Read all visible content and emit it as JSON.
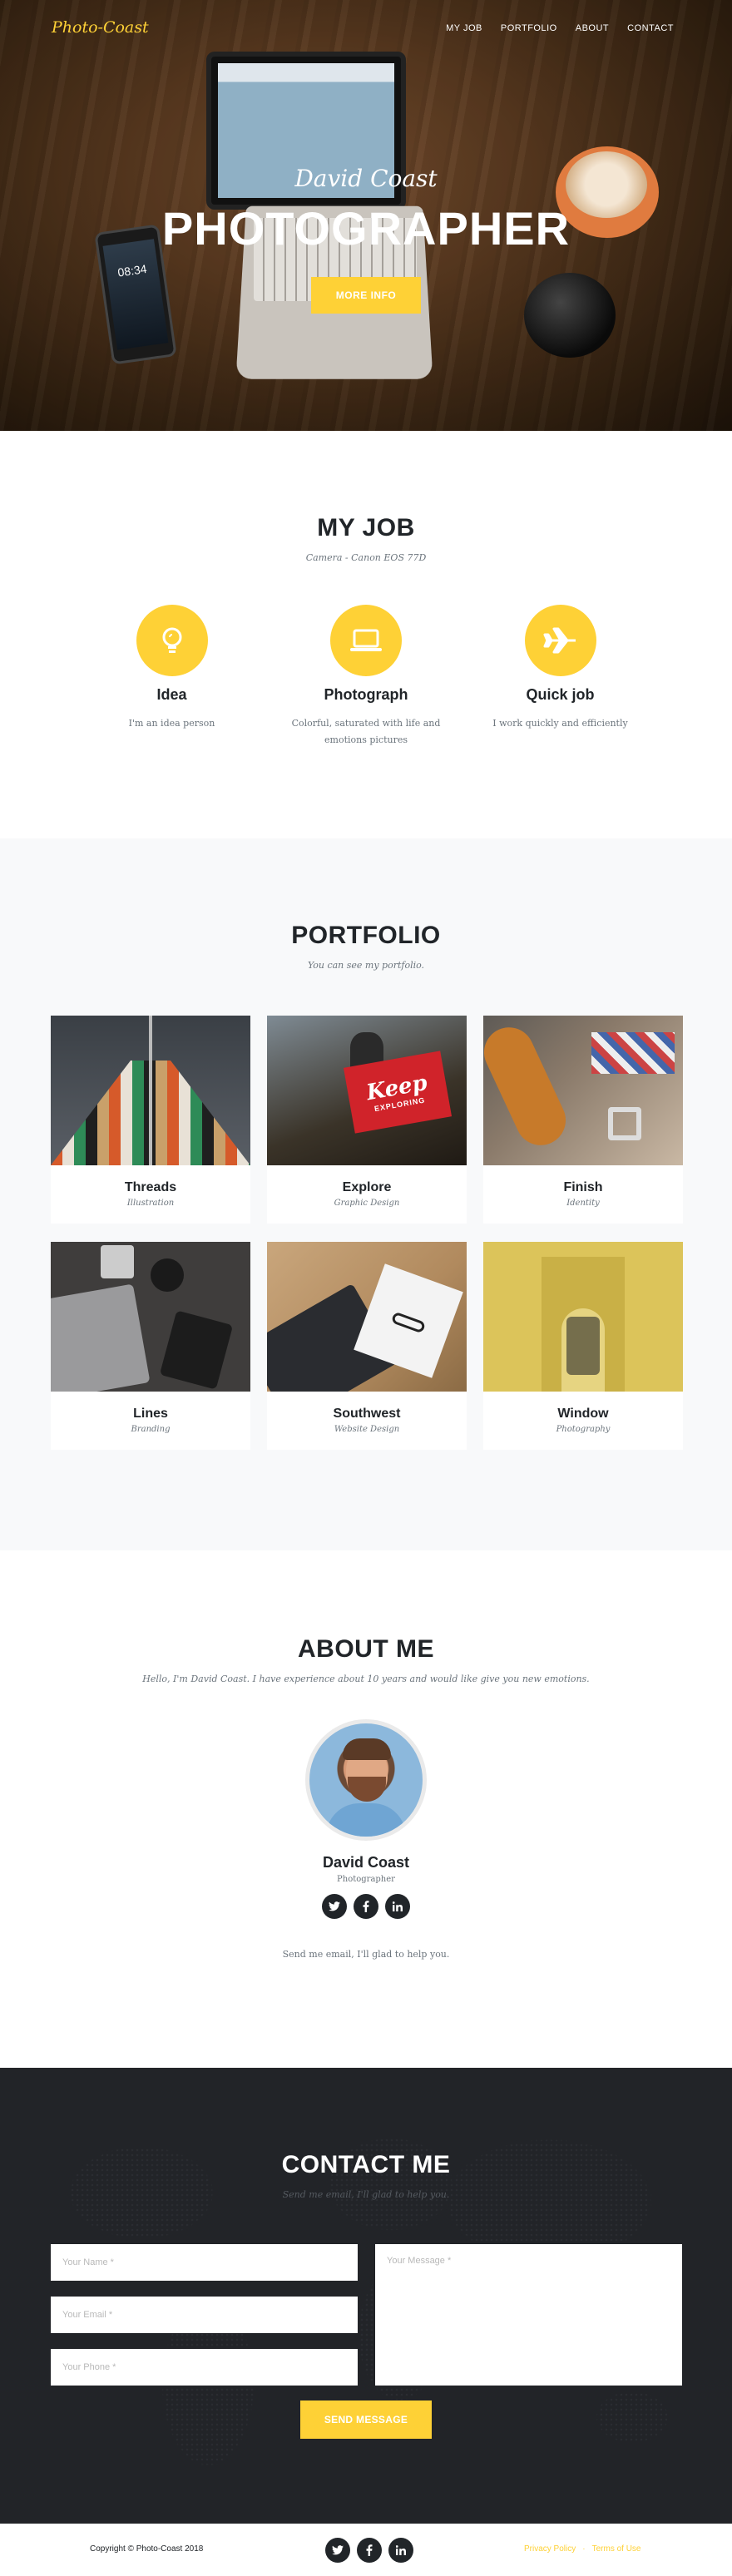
{
  "brand": "Photo-Coast",
  "nav": [
    "MY JOB",
    "PORTFOLIO",
    "ABOUT",
    "CONTACT"
  ],
  "hero": {
    "subtitle": "David Coast",
    "title": "PHOTOGRAPHER",
    "button": "MORE INFO",
    "phone_time": "08:34"
  },
  "job": {
    "title": "MY JOB",
    "subtitle": "Camera - Canon EOS 77D",
    "services": [
      {
        "icon": "lightbulb-icon",
        "title": "Idea",
        "text": "I'm an idea person"
      },
      {
        "icon": "laptop-icon",
        "title": "Photograph",
        "text": "Colorful, saturated with life and emotions pictures"
      },
      {
        "icon": "plane-icon",
        "title": "Quick job",
        "text": "I work quickly and efficiently"
      }
    ]
  },
  "portfolio": {
    "title": "PORTFOLIO",
    "subtitle": "You can see my portfolio.",
    "items": [
      {
        "title": "Threads",
        "category": "Illustration"
      },
      {
        "title": "Explore",
        "category": "Graphic Design"
      },
      {
        "title": "Finish",
        "category": "Identity"
      },
      {
        "title": "Lines",
        "category": "Branding"
      },
      {
        "title": "Southwest",
        "category": "Website Design"
      },
      {
        "title": "Window",
        "category": "Photography"
      }
    ],
    "explore_sign": "Keep",
    "explore_sign_sub": "EXPLORING"
  },
  "about": {
    "title": "ABOUT ME",
    "subtitle": "Hello, I'm David Coast. I have experience about 10 years and would like give you new emotions.",
    "name": "David Coast",
    "role": "Photographer",
    "note": "Send me email, I'll glad to help you."
  },
  "contact": {
    "title": "CONTACT ME",
    "subtitle": "Send me email, I'll glad to help you.",
    "name_placeholder": "Your Name *",
    "email_placeholder": "Your Email *",
    "phone_placeholder": "Your Phone *",
    "message_placeholder": "Your Message *",
    "button": "SEND MESSAGE"
  },
  "footer": {
    "copyright": "Copyright © Photo-Coast 2018",
    "links": [
      "Privacy Policy",
      "Terms of Use"
    ],
    "separator": "·"
  },
  "colors": {
    "accent": "#fed136",
    "dark": "#212529",
    "contact_bg": "#222428"
  }
}
